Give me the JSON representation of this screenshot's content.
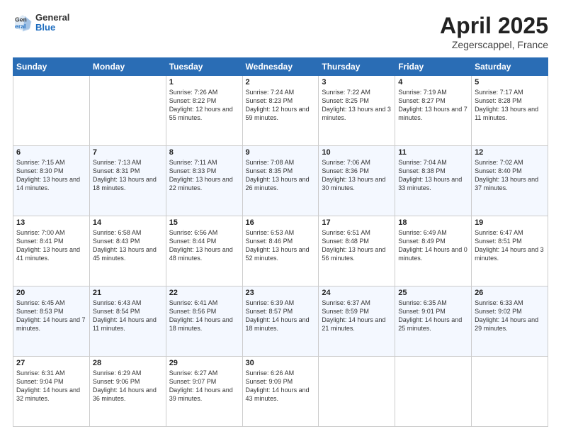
{
  "header": {
    "logo_general": "General",
    "logo_blue": "Blue",
    "month_title": "April 2025",
    "location": "Zegerscappel, France"
  },
  "days_of_week": [
    "Sunday",
    "Monday",
    "Tuesday",
    "Wednesday",
    "Thursday",
    "Friday",
    "Saturday"
  ],
  "weeks": [
    [
      {
        "day": "",
        "sunrise": "",
        "sunset": "",
        "daylight": ""
      },
      {
        "day": "",
        "sunrise": "",
        "sunset": "",
        "daylight": ""
      },
      {
        "day": "1",
        "sunrise": "Sunrise: 7:26 AM",
        "sunset": "Sunset: 8:22 PM",
        "daylight": "Daylight: 12 hours and 55 minutes."
      },
      {
        "day": "2",
        "sunrise": "Sunrise: 7:24 AM",
        "sunset": "Sunset: 8:23 PM",
        "daylight": "Daylight: 12 hours and 59 minutes."
      },
      {
        "day": "3",
        "sunrise": "Sunrise: 7:22 AM",
        "sunset": "Sunset: 8:25 PM",
        "daylight": "Daylight: 13 hours and 3 minutes."
      },
      {
        "day": "4",
        "sunrise": "Sunrise: 7:19 AM",
        "sunset": "Sunset: 8:27 PM",
        "daylight": "Daylight: 13 hours and 7 minutes."
      },
      {
        "day": "5",
        "sunrise": "Sunrise: 7:17 AM",
        "sunset": "Sunset: 8:28 PM",
        "daylight": "Daylight: 13 hours and 11 minutes."
      }
    ],
    [
      {
        "day": "6",
        "sunrise": "Sunrise: 7:15 AM",
        "sunset": "Sunset: 8:30 PM",
        "daylight": "Daylight: 13 hours and 14 minutes."
      },
      {
        "day": "7",
        "sunrise": "Sunrise: 7:13 AM",
        "sunset": "Sunset: 8:31 PM",
        "daylight": "Daylight: 13 hours and 18 minutes."
      },
      {
        "day": "8",
        "sunrise": "Sunrise: 7:11 AM",
        "sunset": "Sunset: 8:33 PM",
        "daylight": "Daylight: 13 hours and 22 minutes."
      },
      {
        "day": "9",
        "sunrise": "Sunrise: 7:08 AM",
        "sunset": "Sunset: 8:35 PM",
        "daylight": "Daylight: 13 hours and 26 minutes."
      },
      {
        "day": "10",
        "sunrise": "Sunrise: 7:06 AM",
        "sunset": "Sunset: 8:36 PM",
        "daylight": "Daylight: 13 hours and 30 minutes."
      },
      {
        "day": "11",
        "sunrise": "Sunrise: 7:04 AM",
        "sunset": "Sunset: 8:38 PM",
        "daylight": "Daylight: 13 hours and 33 minutes."
      },
      {
        "day": "12",
        "sunrise": "Sunrise: 7:02 AM",
        "sunset": "Sunset: 8:40 PM",
        "daylight": "Daylight: 13 hours and 37 minutes."
      }
    ],
    [
      {
        "day": "13",
        "sunrise": "Sunrise: 7:00 AM",
        "sunset": "Sunset: 8:41 PM",
        "daylight": "Daylight: 13 hours and 41 minutes."
      },
      {
        "day": "14",
        "sunrise": "Sunrise: 6:58 AM",
        "sunset": "Sunset: 8:43 PM",
        "daylight": "Daylight: 13 hours and 45 minutes."
      },
      {
        "day": "15",
        "sunrise": "Sunrise: 6:56 AM",
        "sunset": "Sunset: 8:44 PM",
        "daylight": "Daylight: 13 hours and 48 minutes."
      },
      {
        "day": "16",
        "sunrise": "Sunrise: 6:53 AM",
        "sunset": "Sunset: 8:46 PM",
        "daylight": "Daylight: 13 hours and 52 minutes."
      },
      {
        "day": "17",
        "sunrise": "Sunrise: 6:51 AM",
        "sunset": "Sunset: 8:48 PM",
        "daylight": "Daylight: 13 hours and 56 minutes."
      },
      {
        "day": "18",
        "sunrise": "Sunrise: 6:49 AM",
        "sunset": "Sunset: 8:49 PM",
        "daylight": "Daylight: 14 hours and 0 minutes."
      },
      {
        "day": "19",
        "sunrise": "Sunrise: 6:47 AM",
        "sunset": "Sunset: 8:51 PM",
        "daylight": "Daylight: 14 hours and 3 minutes."
      }
    ],
    [
      {
        "day": "20",
        "sunrise": "Sunrise: 6:45 AM",
        "sunset": "Sunset: 8:53 PM",
        "daylight": "Daylight: 14 hours and 7 minutes."
      },
      {
        "day": "21",
        "sunrise": "Sunrise: 6:43 AM",
        "sunset": "Sunset: 8:54 PM",
        "daylight": "Daylight: 14 hours and 11 minutes."
      },
      {
        "day": "22",
        "sunrise": "Sunrise: 6:41 AM",
        "sunset": "Sunset: 8:56 PM",
        "daylight": "Daylight: 14 hours and 18 minutes."
      },
      {
        "day": "23",
        "sunrise": "Sunrise: 6:39 AM",
        "sunset": "Sunset: 8:57 PM",
        "daylight": "Daylight: 14 hours and 18 minutes."
      },
      {
        "day": "24",
        "sunrise": "Sunrise: 6:37 AM",
        "sunset": "Sunset: 8:59 PM",
        "daylight": "Daylight: 14 hours and 21 minutes."
      },
      {
        "day": "25",
        "sunrise": "Sunrise: 6:35 AM",
        "sunset": "Sunset: 9:01 PM",
        "daylight": "Daylight: 14 hours and 25 minutes."
      },
      {
        "day": "26",
        "sunrise": "Sunrise: 6:33 AM",
        "sunset": "Sunset: 9:02 PM",
        "daylight": "Daylight: 14 hours and 29 minutes."
      }
    ],
    [
      {
        "day": "27",
        "sunrise": "Sunrise: 6:31 AM",
        "sunset": "Sunset: 9:04 PM",
        "daylight": "Daylight: 14 hours and 32 minutes."
      },
      {
        "day": "28",
        "sunrise": "Sunrise: 6:29 AM",
        "sunset": "Sunset: 9:06 PM",
        "daylight": "Daylight: 14 hours and 36 minutes."
      },
      {
        "day": "29",
        "sunrise": "Sunrise: 6:27 AM",
        "sunset": "Sunset: 9:07 PM",
        "daylight": "Daylight: 14 hours and 39 minutes."
      },
      {
        "day": "30",
        "sunrise": "Sunrise: 6:26 AM",
        "sunset": "Sunset: 9:09 PM",
        "daylight": "Daylight: 14 hours and 43 minutes."
      },
      {
        "day": "",
        "sunrise": "",
        "sunset": "",
        "daylight": ""
      },
      {
        "day": "",
        "sunrise": "",
        "sunset": "",
        "daylight": ""
      },
      {
        "day": "",
        "sunrise": "",
        "sunset": "",
        "daylight": ""
      }
    ]
  ]
}
